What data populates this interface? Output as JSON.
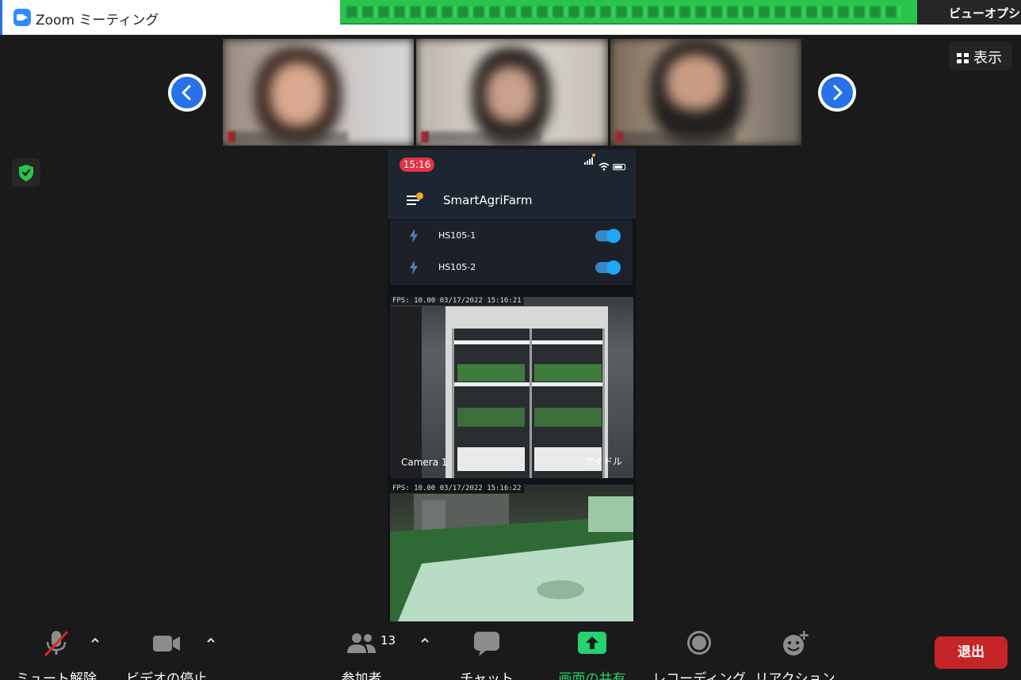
{
  "window": {
    "title": "Zoom ミーティング",
    "view_options_label": "ビューオプショ"
  },
  "header": {
    "display_label": "表示"
  },
  "participants": [
    {
      "tile": "participant-1"
    },
    {
      "tile": "participant-2"
    },
    {
      "tile": "participant-3"
    }
  ],
  "phone": {
    "time": "15:16",
    "app_title": "SmartAgriFarm",
    "devices": [
      {
        "label": "HS105-1",
        "on": true
      },
      {
        "label": "HS105-2",
        "on": true
      }
    ],
    "cameras": [
      {
        "fps": "FPS: 10.00 03/17/2022 15:16:21",
        "label": "Camera 1",
        "state": "アイドル"
      },
      {
        "fps": "FPS: 10.00 03/17/2022 15:16:22",
        "label": "",
        "state": ""
      }
    ]
  },
  "toolbar": {
    "mute": "ミュート解除",
    "video": "ビデオの停止",
    "participants": "参加者",
    "participant_count": "13",
    "chat": "チャット",
    "share": "画面の共有",
    "record": "レコーディング",
    "reactions": "リアクション",
    "leave": "退出"
  },
  "colors": {
    "share_accent": "#26d16f",
    "leave_button": "#c72428",
    "banner": "#2ac34c",
    "toggle": "#1ea7f5"
  },
  "icons": [
    "zoom-app-icon",
    "chevron-left-icon",
    "chevron-right-icon",
    "grid-icon",
    "shield-check-icon",
    "mic-muted-icon",
    "video-camera-icon",
    "people-icon",
    "chat-bubble-icon",
    "share-arrow-icon",
    "record-icon",
    "emoji-add-icon",
    "bolt-icon",
    "hamburger-icon"
  ]
}
